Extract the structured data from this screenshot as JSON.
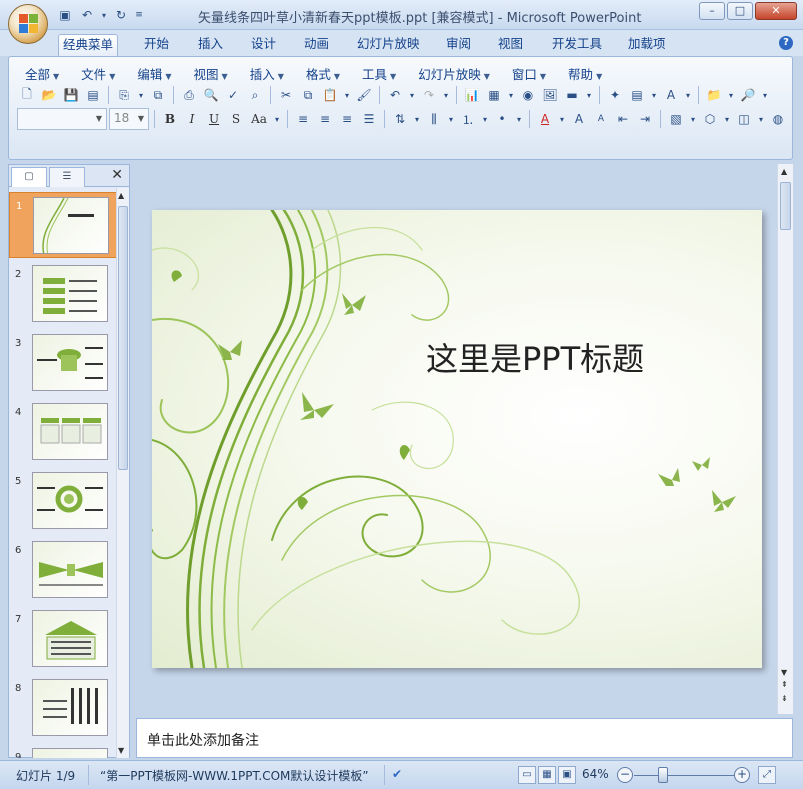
{
  "window": {
    "title": "矢量线条四叶草小清新春天ppt模板.ppt [兼容模式] - Microsoft PowerPoint",
    "controls": {
      "minimize": "–",
      "maximize": "□",
      "close": "✕"
    }
  },
  "quick_access": [
    "save-icon",
    "undo-icon",
    "redo-icon",
    "customize-icon"
  ],
  "tabs": [
    "经典菜单",
    "开始",
    "插入",
    "设计",
    "动画",
    "幻灯片放映",
    "审阅",
    "视图",
    "开发工具",
    "加载项"
  ],
  "active_tab": "经典菜单",
  "menus": [
    "全部",
    "文件",
    "编辑",
    "视图",
    "插入",
    "格式",
    "工具",
    "幻灯片放映",
    "窗口",
    "帮助"
  ],
  "toolbar": {
    "font_name": "",
    "font_size": "18",
    "bold": "B",
    "italic": "I",
    "underline": "U",
    "shadow": "S",
    "case": "Aa"
  },
  "thumbnails": [
    "1",
    "2",
    "3",
    "4",
    "5",
    "6",
    "7",
    "8",
    "9"
  ],
  "selected_slide": 1,
  "slide": {
    "title": "这里是PPT标题"
  },
  "notes_placeholder": "单击此处添加备注",
  "status": {
    "slide_info": "幻灯片 1/9",
    "theme": "“第一PPT模板网-WWW.1PPT.COM默认设计模板”",
    "zoom": "64%"
  },
  "colors": {
    "accent_green": "#7fae3a",
    "selected_thumb": "#f0a35c",
    "ribbon_blue": "#15428b"
  }
}
